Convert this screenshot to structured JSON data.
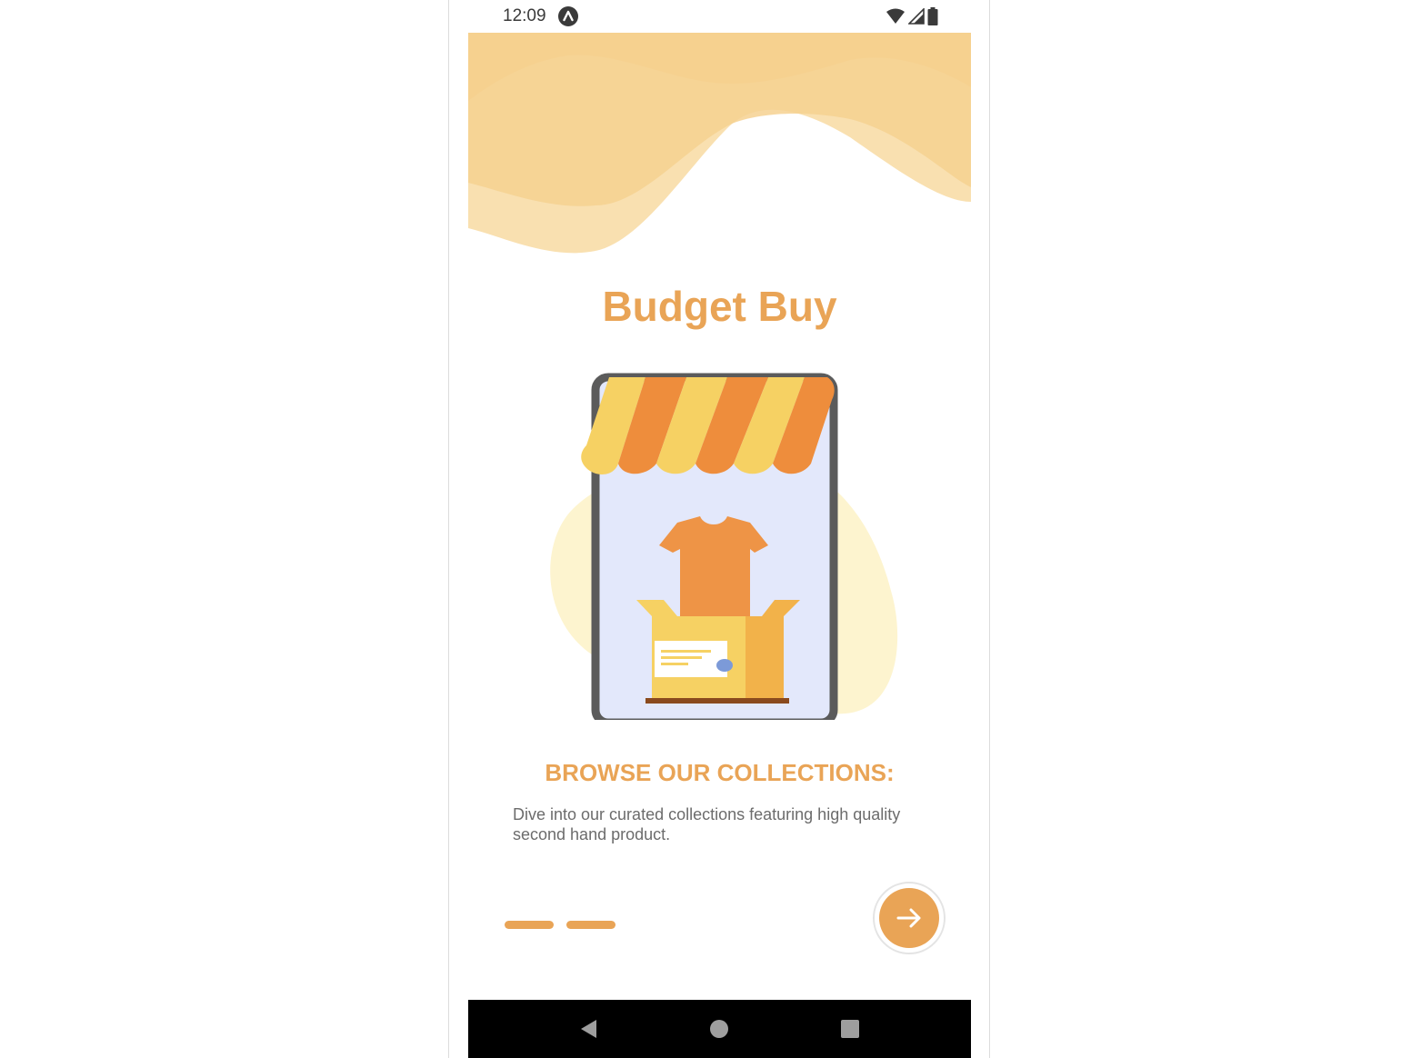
{
  "status_bar": {
    "time": "12:09",
    "app_icon": "nav-app-icon",
    "wifi_icon": "wifi-icon",
    "signal_icon": "signal-icon",
    "battery_icon": "battery-icon"
  },
  "header": {
    "app_title": "Budget Buy"
  },
  "onboarding": {
    "illustration": "storefront-illustration",
    "heading": "BROWSE OUR COLLECTIONS:",
    "description": "Dive into our curated collections featuring high quality second hand product.",
    "pages_shown": 2,
    "next_icon": "arrow-right-icon"
  },
  "nav_bar": {
    "back_icon": "back-triangle-icon",
    "home_icon": "home-circle-icon",
    "recents_icon": "recents-square-icon"
  },
  "colors": {
    "accent": "#e9a456",
    "wave_light": "#f9e0b0",
    "wave_mid": "#f6d08f",
    "nav_bar": "#000000"
  }
}
